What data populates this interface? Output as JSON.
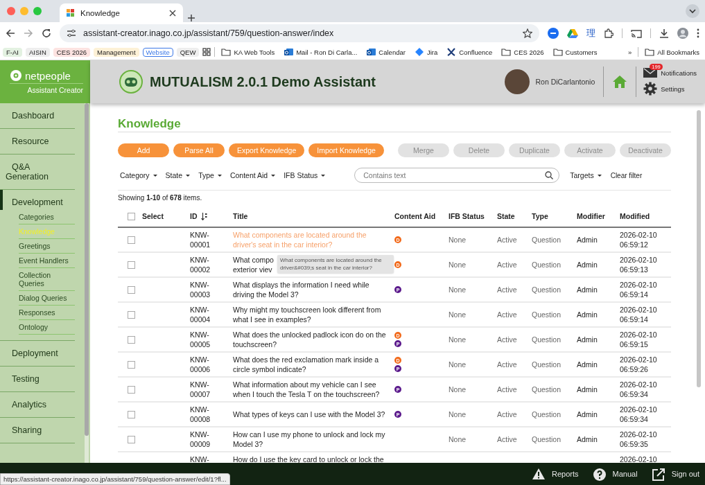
{
  "browser": {
    "tabs": [
      {
        "label": "Knowledge",
        "selected": true
      }
    ],
    "address": "assistant-creator.inago.co.jp/assistant/759/question-answer/index",
    "extension_glyph": "理",
    "bookmarks": [
      {
        "label": "F-AI",
        "kind": "chip",
        "color": "#e3f1e1"
      },
      {
        "label": "AISIN",
        "kind": "chip",
        "color": "#eeeeee"
      },
      {
        "label": "CES 2026",
        "kind": "chip",
        "color": "#fde3e1"
      },
      {
        "label": "Management",
        "kind": "chip",
        "color": "#fdf1d6"
      },
      {
        "label": "Website",
        "kind": "outlined",
        "color": "#3b78e7"
      },
      {
        "label": "QEW",
        "kind": "chip",
        "color": "#eeeeee"
      },
      {
        "kind": "apps"
      },
      {
        "label": "KA Web Tools",
        "kind": "folder"
      },
      {
        "label": "Mail - Ron Di Carla...",
        "kind": "outlook"
      },
      {
        "label": "Calendar",
        "kind": "outlook"
      },
      {
        "label": "Jira",
        "kind": "jira"
      },
      {
        "label": "Confluence",
        "kind": "confluence"
      },
      {
        "label": "CES 2026",
        "kind": "folder"
      },
      {
        "label": "Customers",
        "kind": "folder"
      }
    ],
    "more": "»",
    "all_bookmarks": "All Bookmarks"
  },
  "sidebar": {
    "brand": "netpeople",
    "subtitle": "Assistant Creator",
    "items": [
      {
        "label": "Dashboard",
        "selected": false
      },
      {
        "label": "Resource",
        "selected": false
      },
      {
        "label": "Q&A Generation",
        "selected": false
      },
      {
        "label": "Development",
        "selected": true,
        "expanded": true,
        "children": [
          {
            "label": "Categories",
            "selected": false
          },
          {
            "label": "Knowledge",
            "selected": true
          },
          {
            "label": "Greetings",
            "selected": false
          },
          {
            "label": "Event Handlers",
            "selected": false
          },
          {
            "label": "Collection Queries",
            "selected": false
          },
          {
            "label": "Dialog Queries",
            "selected": false
          },
          {
            "label": "Responses",
            "selected": false
          },
          {
            "label": "Ontology",
            "selected": false
          }
        ]
      },
      {
        "label": "Deployment",
        "selected": false
      },
      {
        "label": "Testing",
        "selected": false
      },
      {
        "label": "Analytics",
        "selected": false
      },
      {
        "label": "Sharing",
        "selected": false
      }
    ]
  },
  "header": {
    "title": "MUTUALISM 2.0.1 Demo Assistant",
    "user": "Ron DiCarlantonio",
    "notifications_badge": "199",
    "notifications": "Notifications",
    "settings": "Settings"
  },
  "page": {
    "title": "Knowledge",
    "actions": [
      {
        "label": "Add",
        "disabled": false
      },
      {
        "label": "Parse All",
        "disabled": false
      },
      {
        "label": "Export Knowledge",
        "disabled": false
      },
      {
        "label": "Import Knowledge",
        "disabled": false
      },
      {
        "label": "Merge",
        "disabled": true
      },
      {
        "label": "Delete",
        "disabled": true
      },
      {
        "label": "Duplicate",
        "disabled": true
      },
      {
        "label": "Activate",
        "disabled": true
      },
      {
        "label": "Deactivate",
        "disabled": true
      }
    ],
    "filters": [
      "Category",
      "State",
      "Type",
      "Content Aid",
      "IFB Status"
    ],
    "search": {
      "placeholder": "Contains text"
    },
    "targets": "Targets",
    "clear_filter": "Clear filter",
    "showing": "Showing **1-10** of **678** items."
  },
  "table": {
    "select_all_checked": false,
    "columns": [
      "Select",
      "ID",
      "Title",
      "Content Aid",
      "IFB Status",
      "State",
      "Type",
      "Modifier",
      "Modified"
    ],
    "rows": [
      {
        "checked": false,
        "highlighted": true,
        "id": "KNW-00001",
        "title": "What components are located around the driver's seat in the car interior?",
        "aids": [
          {
            "letter": "D",
            "color": "#f26a1b"
          }
        ],
        "ifb": "None",
        "state": "Active",
        "type": "Question",
        "modifier": "Admin",
        "modified": "2026-02-10 06:59:12"
      },
      {
        "checked": false,
        "highlighted": false,
        "id": "KNW-00002",
        "title": "What compo\nexterior viev",
        "tooltip": "What components are located around the driver&#039;s seat in the car interior?",
        "aids": [
          {
            "letter": "D",
            "color": "#f26a1b"
          }
        ],
        "ifb": "None",
        "state": "Active",
        "type": "Question",
        "modifier": "Admin",
        "modified": "2026-02-10 06:59:13"
      },
      {
        "checked": false,
        "highlighted": false,
        "id": "KNW-00003",
        "title": "What displays the information I need while driving the Model 3?",
        "aids": [
          {
            "letter": "P",
            "color": "#5b1a8c"
          }
        ],
        "ifb": "None",
        "state": "Active",
        "type": "Question",
        "modifier": "Admin",
        "modified": "2026-02-10 06:59:14"
      },
      {
        "checked": false,
        "highlighted": false,
        "id": "KNW-00004",
        "title": "Why might my touchscreen look different from what I see in examples?",
        "aids": [],
        "ifb": "None",
        "state": "Active",
        "type": "Question",
        "modifier": "Admin",
        "modified": "2026-02-10 06:59:14"
      },
      {
        "checked": false,
        "highlighted": false,
        "id": "KNW-00005",
        "title": "What does the unlocked padlock icon do on the touchscreen?",
        "aids": [
          {
            "letter": "D",
            "color": "#f26a1b"
          },
          {
            "letter": "P",
            "color": "#5b1a8c"
          }
        ],
        "ifb": "None",
        "state": "Active",
        "type": "Question",
        "modifier": "Admin",
        "modified": "2026-02-10 06:59:15"
      },
      {
        "checked": false,
        "highlighted": false,
        "id": "KNW-00006",
        "title": "What does the red exclamation mark inside a circle symbol indicate?",
        "aids": [
          {
            "letter": "D",
            "color": "#f26a1b"
          },
          {
            "letter": "P",
            "color": "#5b1a8c"
          }
        ],
        "ifb": "None",
        "state": "Active",
        "type": "Question",
        "modifier": "Admin",
        "modified": "2026-02-10 06:59:26"
      },
      {
        "checked": false,
        "highlighted": false,
        "id": "KNW-00007",
        "title": "What information about my vehicle can I see when I touch the Tesla T on the touchscreen?",
        "aids": [
          {
            "letter": "P",
            "color": "#5b1a8c"
          }
        ],
        "ifb": "None",
        "state": "Active",
        "type": "Question",
        "modifier": "Admin",
        "modified": "2026-02-10 06:59:34"
      },
      {
        "checked": false,
        "highlighted": false,
        "id": "KNW-00008",
        "title": "What types of keys can I use with the Model 3?",
        "aids": [
          {
            "letter": "P",
            "color": "#5b1a8c"
          }
        ],
        "ifb": "None",
        "state": "Active",
        "type": "Question",
        "modifier": "Admin",
        "modified": "2026-02-10 06:59:34"
      },
      {
        "checked": false,
        "highlighted": false,
        "id": "KNW-00009",
        "title": "How can I use my phone to unlock and lock my Model 3?",
        "aids": [],
        "ifb": "None",
        "state": "Active",
        "type": "Question",
        "modifier": "Admin",
        "modified": "2026-02-10 06:59:35"
      },
      {
        "highlighted": false,
        "id": "KNW-",
        "title": "How do I use the key card to unlock or lock the",
        "aids": [],
        "modified": "2026-02-10"
      }
    ]
  },
  "footer": {
    "links": [
      "Reports",
      "Manual",
      "Sign out"
    ]
  },
  "status_url": "https://assistant-creator.inago.co.jp/assistant/759/question-answer/edit/1?fl..."
}
